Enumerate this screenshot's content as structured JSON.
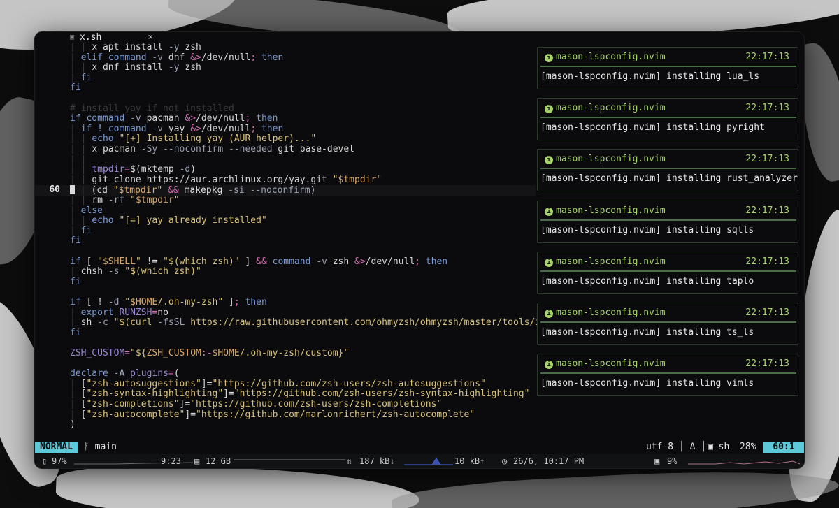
{
  "tab": {
    "icon": "file-icon",
    "filename": "x.sh",
    "close": "×"
  },
  "editor": {
    "current_line_number": "60",
    "lines": [
      {
        "n": "",
        "cur": false,
        "segs": [
          [
            "t-guide",
            "| | "
          ],
          [
            "t-plain",
            "x apt install "
          ],
          [
            "t-flag",
            "-y"
          ],
          [
            "t-plain",
            " zsh"
          ]
        ]
      },
      {
        "n": "",
        "cur": false,
        "segs": [
          [
            "t-guide",
            "| "
          ],
          [
            "t-kw",
            "elif command "
          ],
          [
            "t-flag",
            "-v"
          ],
          [
            "t-plain",
            " dnf "
          ],
          [
            "t-op",
            "&>"
          ],
          [
            "t-plain",
            "/dev/null"
          ],
          [
            "t-op",
            ";"
          ],
          [
            "t-kw",
            " then"
          ]
        ]
      },
      {
        "n": "",
        "cur": false,
        "segs": [
          [
            "t-guide",
            "| | "
          ],
          [
            "t-plain",
            "x dnf install "
          ],
          [
            "t-flag",
            "-y"
          ],
          [
            "t-plain",
            " zsh"
          ]
        ]
      },
      {
        "n": "",
        "cur": false,
        "segs": [
          [
            "t-guide",
            "| "
          ],
          [
            "t-kw",
            "fi"
          ]
        ]
      },
      {
        "n": "",
        "cur": false,
        "segs": [
          [
            "t-kw",
            "fi"
          ]
        ]
      },
      {
        "n": "",
        "cur": false,
        "segs": []
      },
      {
        "n": "",
        "cur": false,
        "segs": [
          [
            "t-cmt",
            "# install yay if not installed"
          ]
        ]
      },
      {
        "n": "",
        "cur": false,
        "segs": [
          [
            "t-kw",
            "if command "
          ],
          [
            "t-flag",
            "-v"
          ],
          [
            "t-plain",
            " pacman "
          ],
          [
            "t-op",
            "&>"
          ],
          [
            "t-plain",
            "/dev/null"
          ],
          [
            "t-op",
            ";"
          ],
          [
            "t-kw",
            " then"
          ]
        ]
      },
      {
        "n": "",
        "cur": false,
        "segs": [
          [
            "t-guide",
            "| "
          ],
          [
            "t-kw",
            "if ! command "
          ],
          [
            "t-flag",
            "-v"
          ],
          [
            "t-plain",
            " yay "
          ],
          [
            "t-op",
            "&>"
          ],
          [
            "t-plain",
            "/dev/null"
          ],
          [
            "t-op",
            ";"
          ],
          [
            "t-kw",
            " then"
          ]
        ]
      },
      {
        "n": "",
        "cur": false,
        "segs": [
          [
            "t-guide",
            "| | "
          ],
          [
            "t-kw",
            "echo "
          ],
          [
            "t-str",
            "\"[+] Installing yay (AUR helper)...\""
          ]
        ]
      },
      {
        "n": "",
        "cur": false,
        "segs": [
          [
            "t-guide",
            "| | "
          ],
          [
            "t-plain",
            "x pacman "
          ],
          [
            "t-flag",
            "-Sy --noconfirm --needed"
          ],
          [
            "t-plain",
            " git base-devel"
          ]
        ]
      },
      {
        "n": "",
        "cur": false,
        "segs": [
          [
            "t-guide",
            "| |"
          ]
        ]
      },
      {
        "n": "",
        "cur": false,
        "segs": [
          [
            "t-guide",
            "| | "
          ],
          [
            "t-name",
            "tmpdir"
          ],
          [
            "t-op",
            "="
          ],
          [
            "t-plain",
            "$(mktemp "
          ],
          [
            "t-flag",
            "-d"
          ],
          [
            "t-plain",
            ")"
          ]
        ]
      },
      {
        "n": "",
        "cur": false,
        "segs": [
          [
            "t-guide",
            "| | "
          ],
          [
            "t-plain",
            "git clone https://aur.archlinux.org/yay.git "
          ],
          [
            "t-str",
            "\""
          ],
          [
            "t-var",
            "$tmpdir"
          ],
          [
            "t-str",
            "\""
          ]
        ]
      },
      {
        "n": "60",
        "cur": true,
        "segs": [
          [
            "cursor",
            ""
          ],
          [
            "t-guide",
            " | "
          ],
          [
            "t-plain",
            "(cd "
          ],
          [
            "t-str",
            "\""
          ],
          [
            "t-var",
            "$tmpdir"
          ],
          [
            "t-str",
            "\""
          ],
          [
            "t-op",
            " && "
          ],
          [
            "t-plain",
            "makepkg "
          ],
          [
            "t-flag",
            "-si --noconfirm"
          ],
          [
            "t-plain",
            ")"
          ]
        ]
      },
      {
        "n": "",
        "cur": false,
        "segs": [
          [
            "t-guide",
            "| | "
          ],
          [
            "t-plain",
            "rm "
          ],
          [
            "t-flag",
            "-rf"
          ],
          [
            "t-plain",
            " "
          ],
          [
            "t-str",
            "\""
          ],
          [
            "t-var",
            "$tmpdir"
          ],
          [
            "t-str",
            "\""
          ]
        ]
      },
      {
        "n": "",
        "cur": false,
        "segs": [
          [
            "t-guide",
            "| "
          ],
          [
            "t-kw",
            "else"
          ]
        ]
      },
      {
        "n": "",
        "cur": false,
        "segs": [
          [
            "t-guide",
            "| | "
          ],
          [
            "t-kw",
            "echo "
          ],
          [
            "t-str",
            "\"[=] yay already installed\""
          ]
        ]
      },
      {
        "n": "",
        "cur": false,
        "segs": [
          [
            "t-guide",
            "| "
          ],
          [
            "t-kw",
            "fi"
          ]
        ]
      },
      {
        "n": "",
        "cur": false,
        "segs": [
          [
            "t-kw",
            "fi"
          ]
        ]
      },
      {
        "n": "",
        "cur": false,
        "segs": []
      },
      {
        "n": "",
        "cur": false,
        "segs": [
          [
            "t-kw",
            "if "
          ],
          [
            "t-plain",
            "[ "
          ],
          [
            "t-str",
            "\""
          ],
          [
            "t-var",
            "$SHELL"
          ],
          [
            "t-str",
            "\""
          ],
          [
            "t-plain",
            " != "
          ],
          [
            "t-str",
            "\"$(which zsh)\""
          ],
          [
            "t-plain",
            " ] "
          ],
          [
            "t-op",
            "&&"
          ],
          [
            "t-kw",
            " command "
          ],
          [
            "t-flag",
            "-v"
          ],
          [
            "t-plain",
            " zsh "
          ],
          [
            "t-op",
            "&>"
          ],
          [
            "t-plain",
            "/dev/null"
          ],
          [
            "t-op",
            ";"
          ],
          [
            "t-kw",
            " then"
          ]
        ]
      },
      {
        "n": "",
        "cur": false,
        "segs": [
          [
            "t-guide",
            "| "
          ],
          [
            "t-plain",
            "chsh "
          ],
          [
            "t-flag",
            "-s"
          ],
          [
            "t-plain",
            " "
          ],
          [
            "t-str",
            "\"$(which zsh)\""
          ]
        ]
      },
      {
        "n": "",
        "cur": false,
        "segs": [
          [
            "t-kw",
            "fi"
          ]
        ]
      },
      {
        "n": "",
        "cur": false,
        "segs": []
      },
      {
        "n": "",
        "cur": false,
        "segs": [
          [
            "t-kw",
            "if "
          ],
          [
            "t-plain",
            "[ ! "
          ],
          [
            "t-flag",
            "-d"
          ],
          [
            "t-plain",
            " "
          ],
          [
            "t-str",
            "\""
          ],
          [
            "t-var",
            "$HOME"
          ],
          [
            "t-str",
            "/.oh-my-zsh\""
          ],
          [
            "t-plain",
            " ]"
          ],
          [
            "t-op",
            ";"
          ],
          [
            "t-kw",
            " then"
          ]
        ]
      },
      {
        "n": "",
        "cur": false,
        "segs": [
          [
            "t-guide",
            "| "
          ],
          [
            "t-kw",
            "export "
          ],
          [
            "t-name",
            "RUNZSH"
          ],
          [
            "t-op",
            "="
          ],
          [
            "t-plain",
            "no"
          ]
        ]
      },
      {
        "n": "",
        "cur": false,
        "segs": [
          [
            "t-guide",
            "| "
          ],
          [
            "t-plain",
            "sh "
          ],
          [
            "t-flag",
            "-c"
          ],
          [
            "t-plain",
            " "
          ],
          [
            "t-str",
            "\"$(curl "
          ],
          [
            "t-flag",
            "-fsSL"
          ],
          [
            "t-str",
            " https://raw.githubusercontent.com/ohmyzsh/ohmyzsh/master/tools/instal"
          ]
        ]
      },
      {
        "n": "",
        "cur": false,
        "segs": [
          [
            "t-kw",
            "fi"
          ]
        ]
      },
      {
        "n": "",
        "cur": false,
        "segs": []
      },
      {
        "n": "",
        "cur": false,
        "segs": [
          [
            "t-name",
            "ZSH_CUSTOM"
          ],
          [
            "t-op",
            "="
          ],
          [
            "t-str",
            "\"${"
          ],
          [
            "t-var",
            "ZSH_CUSTOM"
          ],
          [
            "t-op",
            ":-"
          ],
          [
            "t-var",
            "$HOME"
          ],
          [
            "t-str",
            "/.oh-my-zsh/custom}\""
          ]
        ]
      },
      {
        "n": "",
        "cur": false,
        "segs": []
      },
      {
        "n": "",
        "cur": false,
        "segs": [
          [
            "t-kw",
            "declare "
          ],
          [
            "t-flag",
            "-A"
          ],
          [
            "t-plain",
            " "
          ],
          [
            "t-name",
            "plugins"
          ],
          [
            "t-op",
            "="
          ],
          [
            "t-plain",
            "("
          ]
        ]
      },
      {
        "n": "",
        "cur": false,
        "segs": [
          [
            "t-guide",
            "| "
          ],
          [
            "t-plain",
            "["
          ],
          [
            "t-str",
            "\"zsh-autosuggestions\""
          ],
          [
            "t-plain",
            "]="
          ],
          [
            "t-str",
            "\"https://github.com/zsh-users/zsh-autosuggestions\""
          ]
        ]
      },
      {
        "n": "",
        "cur": false,
        "segs": [
          [
            "t-guide",
            "| "
          ],
          [
            "t-plain",
            "["
          ],
          [
            "t-str",
            "\"zsh-syntax-highlighting\""
          ],
          [
            "t-plain",
            "]="
          ],
          [
            "t-str",
            "\"https://github.com/zsh-users/zsh-syntax-highlighting\""
          ]
        ]
      },
      {
        "n": "",
        "cur": false,
        "segs": [
          [
            "t-guide",
            "| "
          ],
          [
            "t-plain",
            "["
          ],
          [
            "t-str",
            "\"zsh-completions\""
          ],
          [
            "t-plain",
            "]="
          ],
          [
            "t-str",
            "\"https://github.com/zsh-users/zsh-completions\""
          ]
        ]
      },
      {
        "n": "",
        "cur": false,
        "segs": [
          [
            "t-guide",
            "| "
          ],
          [
            "t-plain",
            "["
          ],
          [
            "t-str",
            "\"zsh-autocomplete\""
          ],
          [
            "t-plain",
            "]="
          ],
          [
            "t-str",
            "\"https://github.com/marlonrichert/zsh-autocomplete\""
          ]
        ]
      },
      {
        "n": "",
        "cur": false,
        "segs": [
          [
            "t-plain",
            ")"
          ]
        ]
      }
    ]
  },
  "notifications": [
    {
      "source": "mason-lspconfig.nvim",
      "time": "22:17:13",
      "message": "[mason-lspconfig.nvim] installing lua_ls"
    },
    {
      "source": "mason-lspconfig.nvim",
      "time": "22:17:13",
      "message": "[mason-lspconfig.nvim] installing pyright"
    },
    {
      "source": "mason-lspconfig.nvim",
      "time": "22:17:13",
      "message": "[mason-lspconfig.nvim] installing rust_analyzer"
    },
    {
      "source": "mason-lspconfig.nvim",
      "time": "22:17:13",
      "message": "[mason-lspconfig.nvim] installing sqlls"
    },
    {
      "source": "mason-lspconfig.nvim",
      "time": "22:17:13",
      "message": "[mason-lspconfig.nvim] installing taplo"
    },
    {
      "source": "mason-lspconfig.nvim",
      "time": "22:17:13",
      "message": "[mason-lspconfig.nvim] installing ts_ls"
    },
    {
      "source": "mason-lspconfig.nvim",
      "time": "22:17:13",
      "message": "[mason-lspconfig.nvim] installing vimls"
    }
  ],
  "statusline": {
    "mode": "NORMAL",
    "branch_icon": "ᚠ",
    "branch": "main",
    "encoding": "utf-8",
    "os_icon": "Δ",
    "filetype_icon": "▣",
    "filetype": "sh",
    "percent": "28%",
    "position": "60:1"
  },
  "bar": {
    "battery_icon": "battery-icon",
    "battery": "97%",
    "battery_time": "9:23",
    "mem_icon": "memory-icon",
    "memory": "12 GB",
    "net_icon": "network-icon",
    "download": "187 kB↓",
    "upload": "10 kB↑",
    "clock_icon": "clock-icon",
    "datetime": "26/6, 10:17 PM",
    "cpu_icon": "cpu-icon",
    "cpu": "9%",
    "accent": "#5cc8d8",
    "notif_green": "#a8d36a"
  }
}
